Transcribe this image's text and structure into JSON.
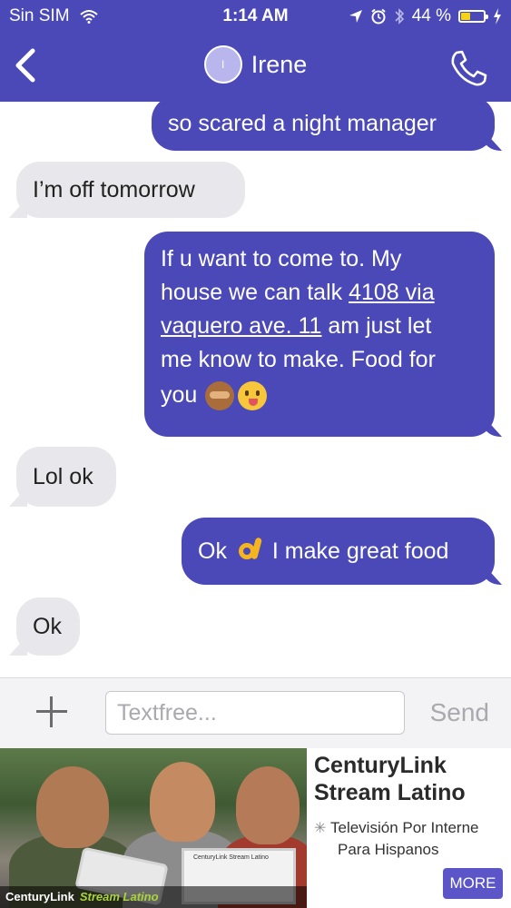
{
  "status_bar": {
    "carrier": "Sin SIM",
    "time": "1:14 AM",
    "battery_percent": "44 %",
    "battery_level": 0.44,
    "icons": [
      "wifi-icon",
      "location-icon",
      "alarm-icon",
      "bluetooth-icon",
      "battery-icon",
      "charging-icon"
    ]
  },
  "header": {
    "contact_name": "Irene",
    "avatar_initial": "I",
    "icons": [
      "back-chevron-icon",
      "phone-icon"
    ]
  },
  "messages": [
    {
      "direction": "sent",
      "text": "so scared a night manager"
    },
    {
      "direction": "received",
      "text": "I’m off tomorrow"
    },
    {
      "direction": "sent",
      "line1": "If u want to come to. My",
      "line2_pre": "house we can talk ",
      "line2_link": "4108 via",
      "line3_link": "vaquero ave.  11",
      "line3_post": " am  just let",
      "line4": "me know to make. Food  for",
      "line5": "you",
      "emojis": [
        "see-no-evil-monkey",
        "face-savoring-food"
      ]
    },
    {
      "direction": "received",
      "text": "Lol ok"
    },
    {
      "direction": "sent",
      "pre": "Ok ",
      "post": " I make great food",
      "emoji": "ok-hand"
    },
    {
      "direction": "received",
      "text": "Ok"
    }
  ],
  "composer": {
    "placeholder": "Textfree...",
    "send_label": "Send"
  },
  "ad": {
    "title_line1": "CenturyLink",
    "title_line2": "Stream Latino",
    "desc_line1": "Televisión Por Interne",
    "desc_line2": "Para Hispanos",
    "more_label": "MORE",
    "caption_brand": "CenturyLink",
    "caption_sub": "Stream Latino",
    "laptop_text": "CenturyLink Stream Latino"
  },
  "colors": {
    "accent": "#4b49b8",
    "received_bubble": "#e8e8ec",
    "more_button": "#5b55c8"
  }
}
